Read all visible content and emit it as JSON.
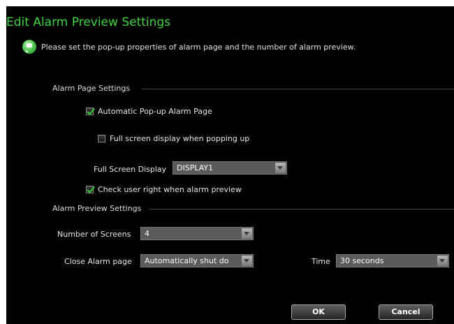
{
  "dialog": {
    "title": "Edit Alarm Preview Settings",
    "hint": "Please set the pop-up properties of alarm page and the number of alarm preview."
  },
  "alarm_page": {
    "section_title": "Alarm Page Settings",
    "auto_popup": {
      "label": "Automatic Pop-up Alarm Page",
      "checked": true
    },
    "full_screen_popup": {
      "label": "Full screen display when popping up",
      "checked": false
    },
    "full_screen_display": {
      "label": "Full Screen Display",
      "value": "DISPLAY1"
    },
    "check_user_right": {
      "label": "Check user right when alarm preview",
      "checked": true
    }
  },
  "alarm_preview": {
    "section_title": "Alarm Preview Settings",
    "number_of_screens": {
      "label": "Number of Screens",
      "value": "4"
    },
    "close_alarm_page": {
      "label": "Close Alarm page",
      "value": "Automatically shut do"
    },
    "time": {
      "label": "Time",
      "value": "30 seconds"
    }
  },
  "buttons": {
    "ok": "OK",
    "cancel": "Cancel"
  },
  "colors": {
    "title": "#3fd23f",
    "background": "#000000",
    "check": "#35d035"
  },
  "icons": {
    "hint": "speech-bubble-icon",
    "dropdown": "chevron-down-icon",
    "check": "check-icon"
  }
}
